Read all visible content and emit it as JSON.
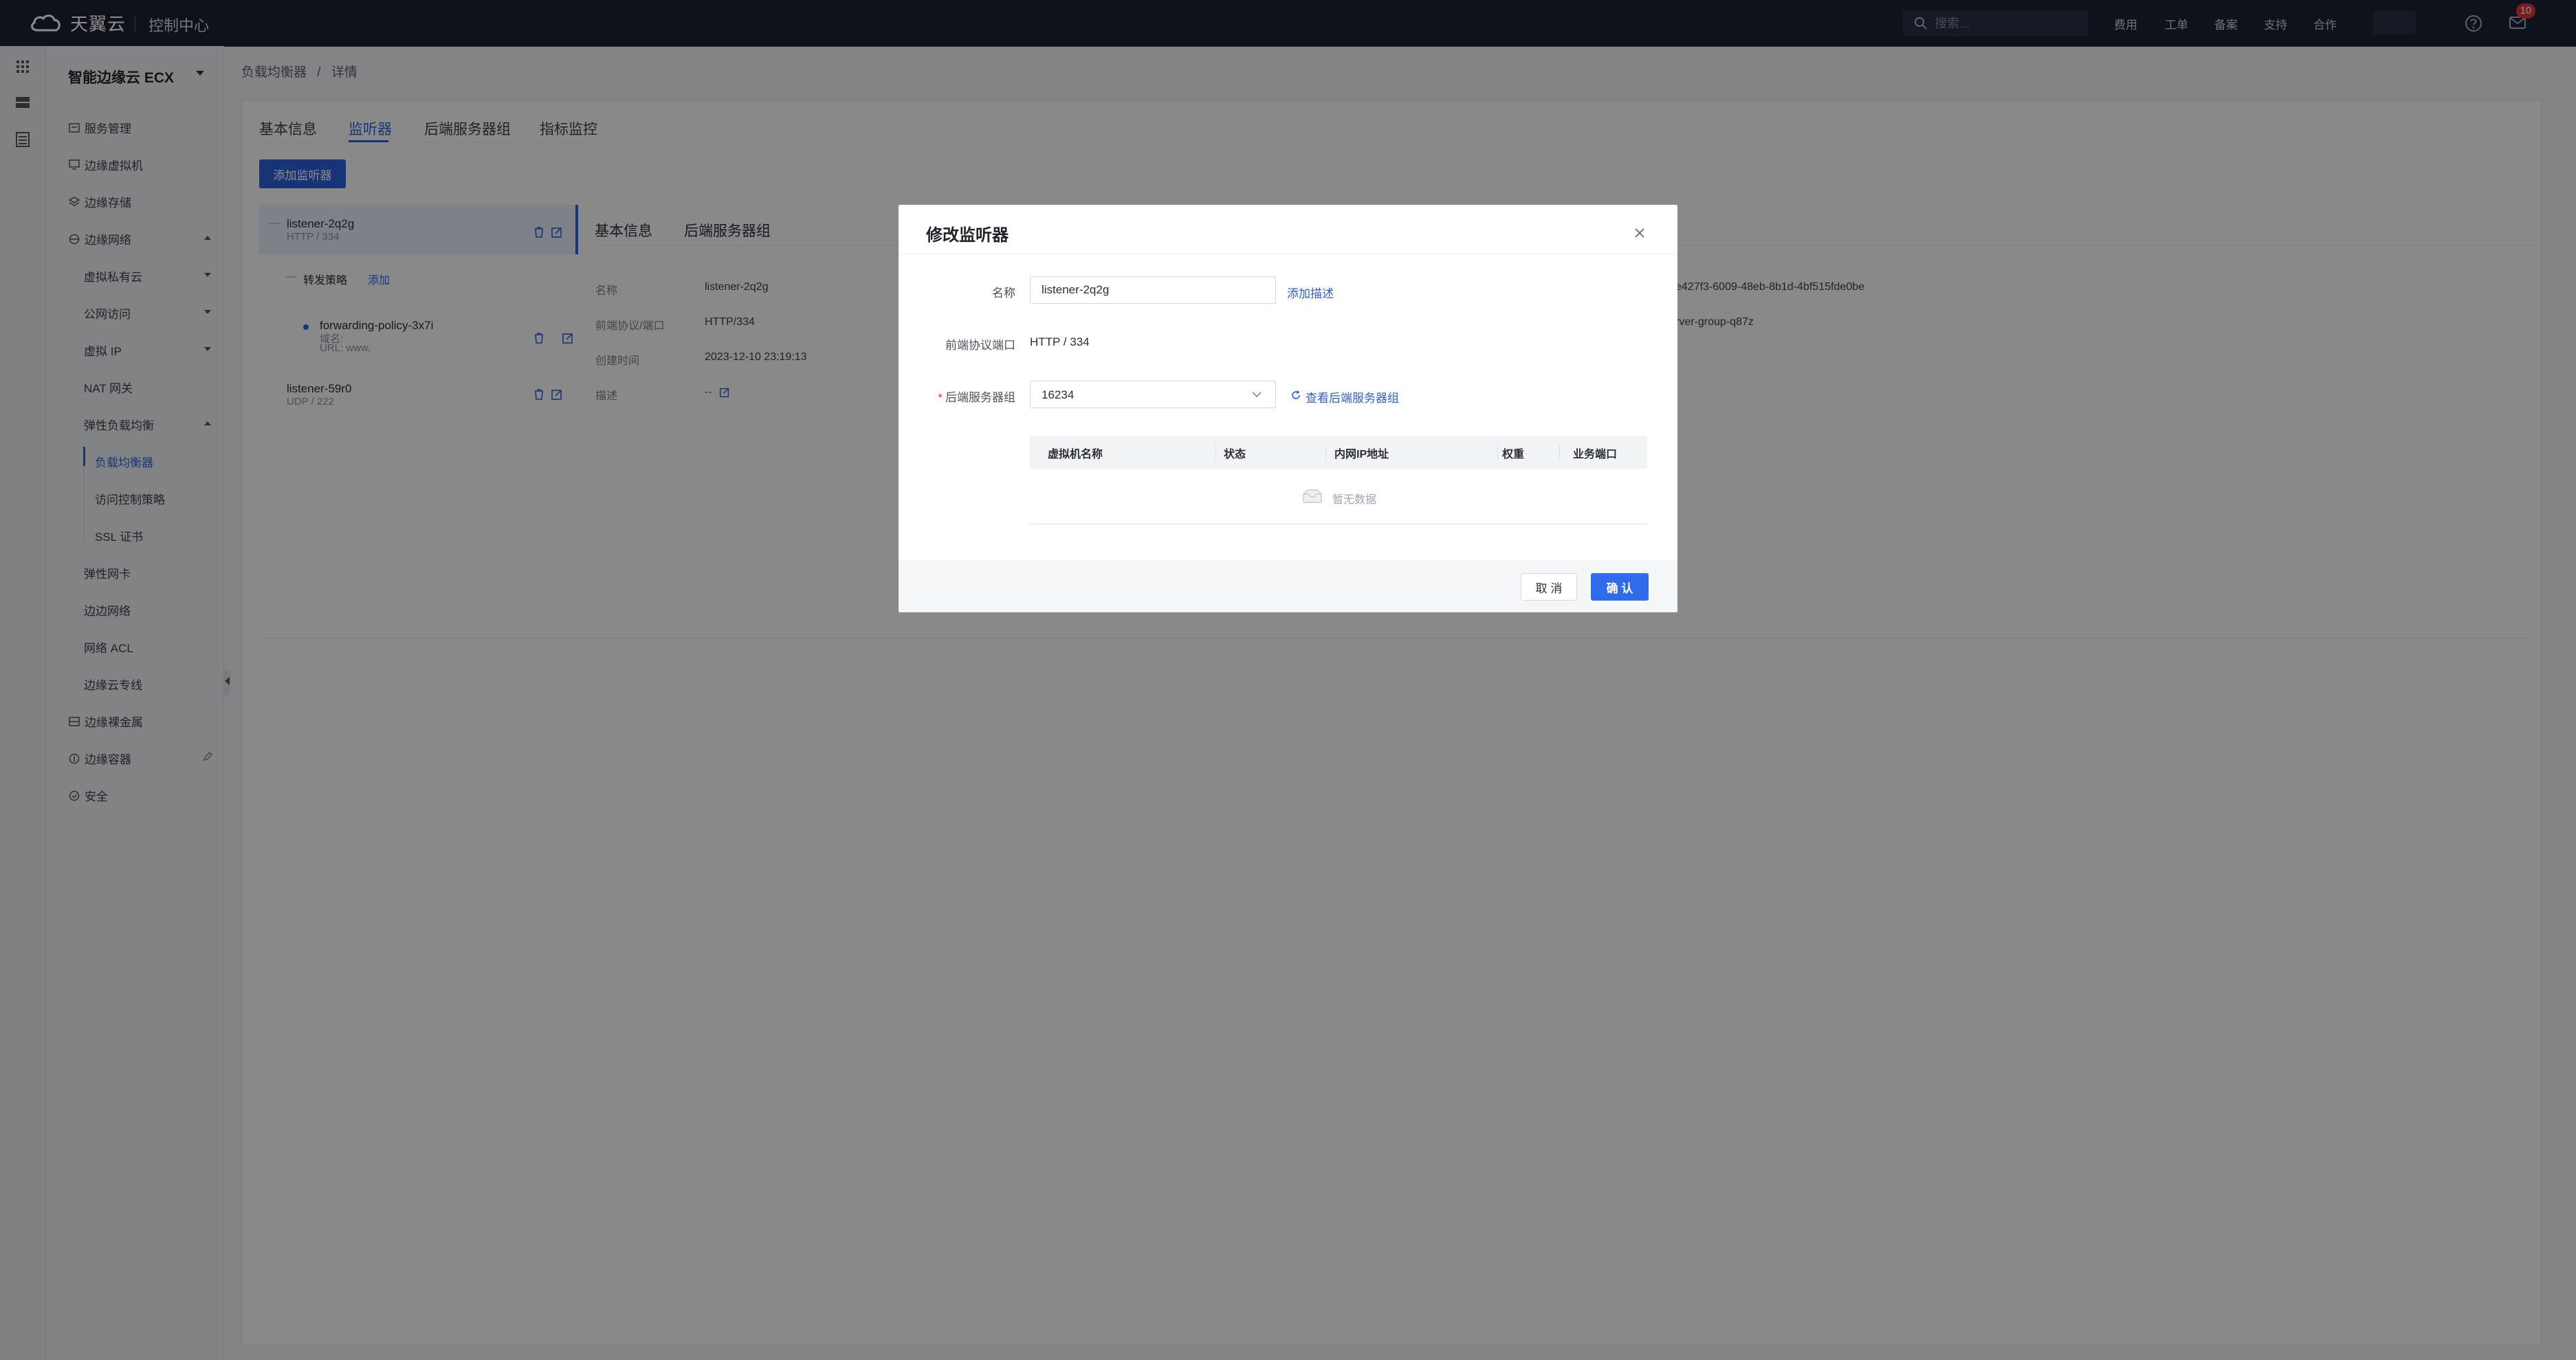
{
  "topbar": {
    "logo_text": "天翼云",
    "console": "控制中心",
    "search_placeholder": "搜索...",
    "nav": [
      "费用",
      "工单",
      "备案",
      "支持",
      "合作"
    ],
    "msg_count": "10"
  },
  "sidebar": {
    "product": "智能边缘云 ECX",
    "items": {
      "service_mgmt": "服务管理",
      "vm": "边缘虚拟机",
      "storage": "边缘存储",
      "network": "边缘网络",
      "vpc": "虚拟私有云",
      "public_access": "公网访问",
      "virtual_ip": "虚拟 IP",
      "nat": "NAT 网关",
      "elb": "弹性负载均衡",
      "lb": "负载均衡器",
      "acl_policy": "访问控制策略",
      "ssl": "SSL 证书",
      "eni": "弹性网卡",
      "edge_network": "边边网络",
      "network_acl": "网络 ACL",
      "direct_connect": "边缘云专线",
      "bare_metal": "边缘裸金属",
      "container": "边缘容器",
      "security": "安全"
    }
  },
  "breadcrumb": {
    "parent": "负载均衡器",
    "sep": "/",
    "current": "详情"
  },
  "tabs": [
    "基本信息",
    "监听器",
    "后端服务器组",
    "指标监控"
  ],
  "add_listener": "添加监听器",
  "listeners": {
    "l1": {
      "name": "listener-2q2g",
      "sub": "HTTP / 334"
    },
    "policy_label": "转发策略",
    "policy_add": "添加",
    "policy": {
      "name": "forwarding-policy-3x7i",
      "domain": "域名:",
      "url": "URL: www,"
    },
    "l2": {
      "name": "listener-59r0",
      "sub": "UDP / 222"
    }
  },
  "detail": {
    "tabs": [
      "基本信息",
      "后端服务器组"
    ],
    "labels": [
      "名称",
      "前端协议/端口",
      "创建时间",
      "描述"
    ],
    "values": {
      "name": "listener-2q2g",
      "port": "HTTP/334",
      "created": "2023-12-10 23:19:13",
      "desc": "--"
    },
    "right1": "e427f3-6009-48eb-8b1d-4bf515fde0be",
    "right2": "rver-group-q87z"
  },
  "modal": {
    "title": "修改监听器",
    "name_label": "名称",
    "name_value": "listener-2q2g",
    "add_desc": "添加描述",
    "port_label": "前端协议端口",
    "port_value": "HTTP / 334",
    "group_label": "后端服务器组",
    "group_value": "16234",
    "view_group": "查看后端服务器组",
    "columns": [
      "虚拟机名称",
      "状态",
      "内网IP地址",
      "权重",
      "业务端口"
    ],
    "empty": "暂无数据",
    "cancel": "取 消",
    "ok": "确 认"
  },
  "colors": {
    "accent": "#2b5fd9",
    "topbar": "#1d2230"
  }
}
